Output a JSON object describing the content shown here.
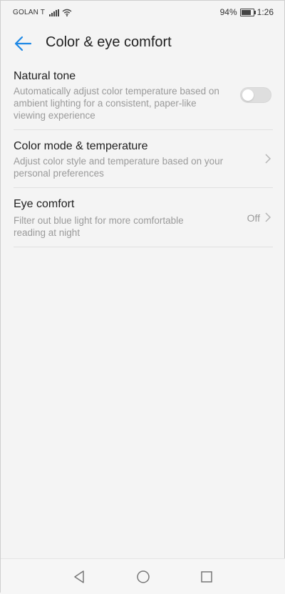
{
  "status_bar": {
    "carrier": "GOLAN T",
    "battery": "94%",
    "battery_level": 0.94,
    "time": "1:26",
    "icons": [
      "signal-icon",
      "wifi-icon",
      "battery-icon"
    ]
  },
  "app_bar": {
    "back_icon": "arrow-left-icon",
    "title": "Color & eye comfort"
  },
  "settings": [
    {
      "title": "Natural tone",
      "subtitle": "Automatically adjust color temperature based on ambient lighting for a consistent, paper-like viewing experience",
      "control": "toggle",
      "toggle_on": false
    },
    {
      "title": "Color mode & temperature",
      "subtitle": "Adjust color style and temperature based on your personal preferences",
      "control": "chevron"
    },
    {
      "title": "Eye comfort",
      "subtitle": "Filter out blue light for more comfortable reading at night",
      "control": "value-chevron",
      "value": "Off"
    }
  ],
  "nav_bar": {
    "icons": [
      "triangle-back-icon",
      "circle-home-icon",
      "square-recents-icon"
    ]
  },
  "colors": {
    "accent": "#1e88e5",
    "background": "#f4f4f4",
    "secondary_text": "#9a9a9a"
  }
}
